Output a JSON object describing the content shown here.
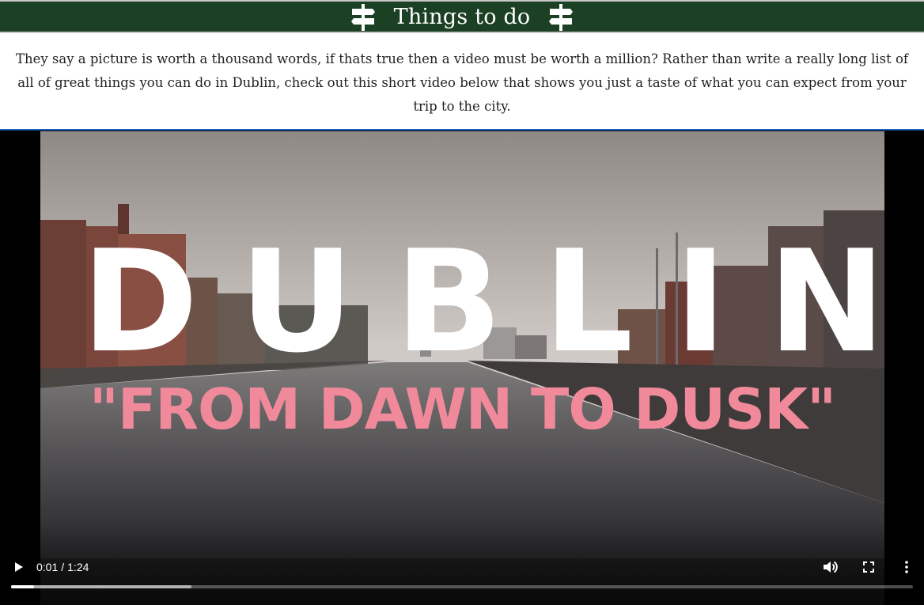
{
  "header": {
    "title": "Things to do",
    "background_color": "#1b4023",
    "left_icon": "signpost-icon",
    "right_icon": "signpost-icon"
  },
  "intro": {
    "text": "They say a picture is worth a thousand words, if thats true then a video must be worth a million? Rather than write a really long list of all of great things you can do in Dublin, check out this short video below that shows you just a taste of what you can expect from your trip to the city."
  },
  "video": {
    "overlay_title": "DUBLIN",
    "overlay_subtitle": "\"FROM DAWN TO DUSK\"",
    "subtitle_color": "#f08a9b",
    "controls": {
      "play_icon": "play-icon",
      "current_time": "0:01",
      "separator": "/",
      "duration": "1:24",
      "volume_icon": "volume-icon",
      "fullscreen_icon": "fullscreen-icon",
      "more_icon": "more-options-icon",
      "played_fraction": 0.025,
      "buffered_fraction": 0.2
    }
  }
}
